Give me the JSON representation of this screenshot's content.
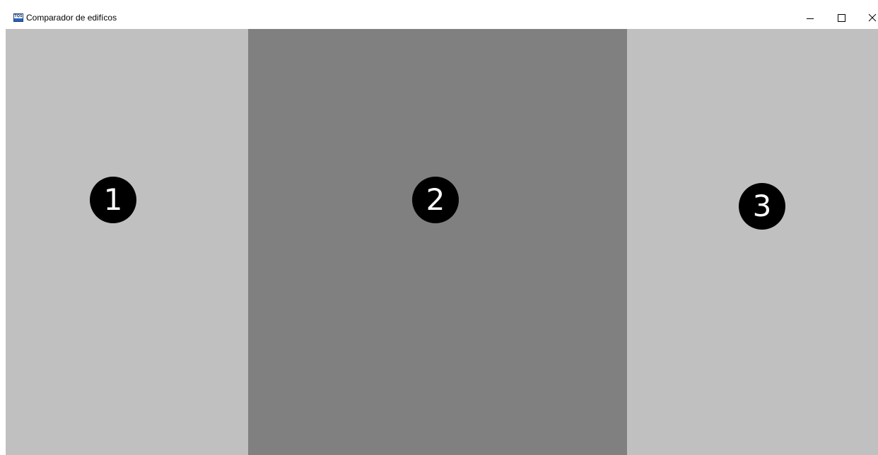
{
  "window": {
    "title": "Comparador de edifícos",
    "app_icon_text": "TQS",
    "controls": {
      "minimize_icon": "minimize-icon",
      "maximize_icon": "maximize-icon",
      "close_icon": "close-icon"
    }
  },
  "panels": [
    {
      "label": "1",
      "background": "#c0c0c0"
    },
    {
      "label": "2",
      "background": "#808080"
    },
    {
      "label": "3",
      "background": "#c0c0c0"
    }
  ],
  "colors": {
    "badge_background": "#000000",
    "badge_text": "#ffffff"
  }
}
